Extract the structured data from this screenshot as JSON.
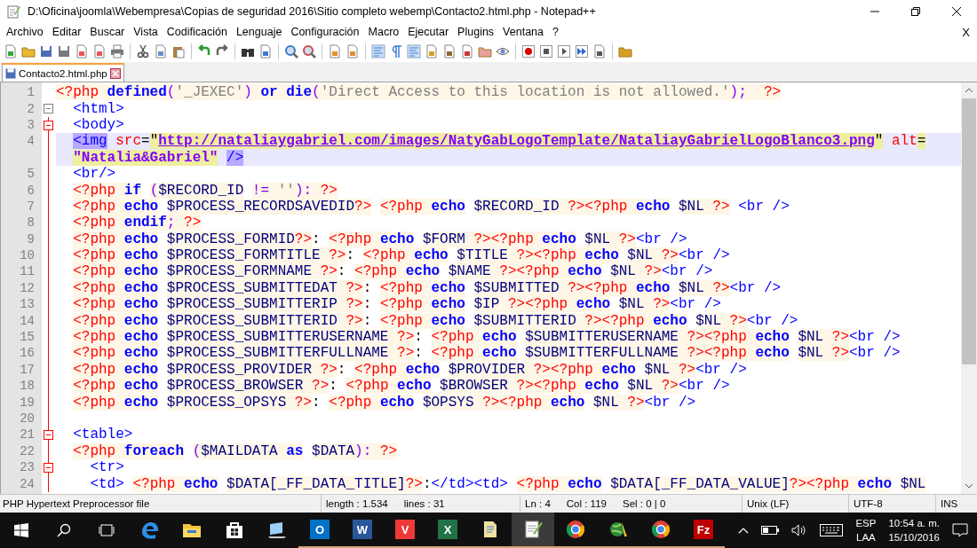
{
  "window": {
    "title": "D:\\Oficina\\joomla\\Webempresa\\Copias de seguridad 2016\\Sitio completo webemp\\Contacto2.html.php - Notepad++"
  },
  "menu": {
    "items": [
      "Archivo",
      "Editar",
      "Buscar",
      "Vista",
      "Codificación",
      "Lenguaje",
      "Configuración",
      "Macro",
      "Ejecutar",
      "Plugins",
      "Ventana",
      "?"
    ],
    "close": "X"
  },
  "tabs": [
    {
      "label": "Contacto2.html.php",
      "selected": true
    }
  ],
  "lines": [
    {
      "number": "1",
      "fold_marker": false,
      "in_block": false,
      "current": false,
      "tokens": [
        {
          "kind": "php",
          "text": "<?php "
        },
        {
          "kind": "kw",
          "text": "defined"
        },
        {
          "kind": "op",
          "text": "("
        },
        {
          "kind": "str",
          "text": "'_JEXEC'"
        },
        {
          "kind": "op",
          "text": ") "
        },
        {
          "kind": "kw",
          "text": "or die"
        },
        {
          "kind": "op",
          "text": "("
        },
        {
          "kind": "str",
          "text": "'Direct Access to this location is not allowed.'"
        },
        {
          "kind": "op",
          "text": ");  "
        },
        {
          "kind": "php",
          "text": "?>"
        }
      ]
    },
    {
      "number": "2",
      "fold_marker": true,
      "in_block": false,
      "current": false,
      "tokens": [
        {
          "kind": "tag",
          "text": "  <html>"
        }
      ]
    },
    {
      "number": "3",
      "fold_marker": true,
      "in_block": true,
      "current": false,
      "tokens": [
        {
          "kind": "tag",
          "text": "  <body>"
        }
      ]
    },
    {
      "number": "4",
      "fold_marker": false,
      "in_block": true,
      "current": true,
      "tokens": [
        {
          "kind": "match",
          "text": "  <img"
        },
        {
          "kind": "attr",
          "text": " src"
        },
        {
          "kind": "text",
          "text": "="
        },
        {
          "kind": "quote",
          "text": "\""
        },
        {
          "kind": "url",
          "text": "http://nataliaygabriel.com/images/NatyGabLogoTemplate/NataliayGabrielLogoBlanco3.png"
        },
        {
          "kind": "quote",
          "text": "\""
        },
        {
          "kind": "attr",
          "text": " alt"
        },
        {
          "kind": "quote",
          "text": "="
        }
      ],
      "continuation": [
        {
          "kind": "value",
          "text": "\"Natalia&Gabriel\""
        },
        {
          "kind": "match",
          "text": " />"
        }
      ]
    },
    {
      "number": "5",
      "fold_marker": false,
      "in_block": true,
      "current": false,
      "tokens": [
        {
          "kind": "tag",
          "text": "  <br/>"
        }
      ]
    },
    {
      "number": "6",
      "fold_marker": false,
      "in_block": true,
      "current": false,
      "tokens": [
        {
          "kind": "php",
          "text": "  <?php "
        },
        {
          "kind": "kw",
          "text": "if"
        },
        {
          "kind": "op",
          "text": " ("
        },
        {
          "kind": "var",
          "text": "$RECORD_ID"
        },
        {
          "kind": "op",
          "text": " != "
        },
        {
          "kind": "str",
          "text": "''"
        },
        {
          "kind": "op",
          "text": "): "
        },
        {
          "kind": "php",
          "text": "?>"
        }
      ]
    },
    {
      "number": "7",
      "fold_marker": false,
      "in_block": true,
      "current": false,
      "tokens": [
        {
          "kind": "php",
          "text": "  <?php "
        },
        {
          "kind": "kw",
          "text": "echo"
        },
        {
          "kind": "var",
          "text": " $PROCESS_RECORDSAVEDID"
        },
        {
          "kind": "php",
          "text": "?>"
        },
        {
          "kind": "php",
          "text": " <?php "
        },
        {
          "kind": "kw",
          "text": "echo"
        },
        {
          "kind": "var",
          "text": " $RECORD_ID "
        },
        {
          "kind": "php",
          "text": "?><?php "
        },
        {
          "kind": "kw",
          "text": "echo"
        },
        {
          "kind": "var",
          "text": " $NL "
        },
        {
          "kind": "php",
          "text": "?>"
        },
        {
          "kind": "tag",
          "text": " <br />"
        }
      ]
    },
    {
      "number": "8",
      "fold_marker": false,
      "in_block": true,
      "current": false,
      "tokens": [
        {
          "kind": "php",
          "text": "  <?php "
        },
        {
          "kind": "kw",
          "text": "endif"
        },
        {
          "kind": "op",
          "text": "; "
        },
        {
          "kind": "php",
          "text": "?>"
        }
      ]
    },
    {
      "number": "9",
      "fold_marker": false,
      "in_block": true,
      "current": false,
      "tokens": [
        {
          "kind": "php",
          "text": "  <?php "
        },
        {
          "kind": "kw",
          "text": "echo"
        },
        {
          "kind": "var",
          "text": " $PROCESS_FORMID"
        },
        {
          "kind": "php",
          "text": "?>"
        },
        {
          "kind": "text",
          "text": ":"
        },
        {
          "kind": "php",
          "text": " <?php "
        },
        {
          "kind": "kw",
          "text": "echo"
        },
        {
          "kind": "var",
          "text": " $FORM "
        },
        {
          "kind": "php",
          "text": "?><?php "
        },
        {
          "kind": "kw",
          "text": "echo"
        },
        {
          "kind": "var",
          "text": " $NL "
        },
        {
          "kind": "php",
          "text": "?>"
        },
        {
          "kind": "tag",
          "text": "<br />"
        }
      ]
    },
    {
      "number": "10",
      "fold_marker": false,
      "in_block": true,
      "current": false,
      "tokens": [
        {
          "kind": "php",
          "text": "  <?php "
        },
        {
          "kind": "kw",
          "text": "echo"
        },
        {
          "kind": "var",
          "text": " $PROCESS_FORMTITLE "
        },
        {
          "kind": "php",
          "text": "?>"
        },
        {
          "kind": "text",
          "text": ":"
        },
        {
          "kind": "php",
          "text": " <?php "
        },
        {
          "kind": "kw",
          "text": "echo"
        },
        {
          "kind": "var",
          "text": " $TITLE "
        },
        {
          "kind": "php",
          "text": "?><?php "
        },
        {
          "kind": "kw",
          "text": "echo"
        },
        {
          "kind": "var",
          "text": " $NL "
        },
        {
          "kind": "php",
          "text": "?>"
        },
        {
          "kind": "tag",
          "text": "<br />"
        }
      ]
    },
    {
      "number": "11",
      "fold_marker": false,
      "in_block": true,
      "current": false,
      "tokens": [
        {
          "kind": "php",
          "text": "  <?php "
        },
        {
          "kind": "kw",
          "text": "echo"
        },
        {
          "kind": "var",
          "text": " $PROCESS_FORMNAME "
        },
        {
          "kind": "php",
          "text": "?>"
        },
        {
          "kind": "text",
          "text": ":"
        },
        {
          "kind": "php",
          "text": " <?php "
        },
        {
          "kind": "kw",
          "text": "echo"
        },
        {
          "kind": "var",
          "text": " $NAME "
        },
        {
          "kind": "php",
          "text": "?><?php "
        },
        {
          "kind": "kw",
          "text": "echo"
        },
        {
          "kind": "var",
          "text": " $NL "
        },
        {
          "kind": "php",
          "text": "?>"
        },
        {
          "kind": "tag",
          "text": "<br />"
        }
      ]
    },
    {
      "number": "12",
      "fold_marker": false,
      "in_block": true,
      "current": false,
      "tokens": [
        {
          "kind": "php",
          "text": "  <?php "
        },
        {
          "kind": "kw",
          "text": "echo"
        },
        {
          "kind": "var",
          "text": " $PROCESS_SUBMITTEDAT "
        },
        {
          "kind": "php",
          "text": "?>"
        },
        {
          "kind": "text",
          "text": ":"
        },
        {
          "kind": "php",
          "text": " <?php "
        },
        {
          "kind": "kw",
          "text": "echo"
        },
        {
          "kind": "var",
          "text": " $SUBMITTED "
        },
        {
          "kind": "php",
          "text": "?><?php "
        },
        {
          "kind": "kw",
          "text": "echo"
        },
        {
          "kind": "var",
          "text": " $NL "
        },
        {
          "kind": "php",
          "text": "?>"
        },
        {
          "kind": "tag",
          "text": "<br />"
        }
      ]
    },
    {
      "number": "13",
      "fold_marker": false,
      "in_block": true,
      "current": false,
      "tokens": [
        {
          "kind": "php",
          "text": "  <?php "
        },
        {
          "kind": "kw",
          "text": "echo"
        },
        {
          "kind": "var",
          "text": " $PROCESS_SUBMITTERIP "
        },
        {
          "kind": "php",
          "text": "?>"
        },
        {
          "kind": "text",
          "text": ":"
        },
        {
          "kind": "php",
          "text": " <?php "
        },
        {
          "kind": "kw",
          "text": "echo"
        },
        {
          "kind": "var",
          "text": " $IP "
        },
        {
          "kind": "php",
          "text": "?><?php "
        },
        {
          "kind": "kw",
          "text": "echo"
        },
        {
          "kind": "var",
          "text": " $NL "
        },
        {
          "kind": "php",
          "text": "?>"
        },
        {
          "kind": "tag",
          "text": "<br />"
        }
      ]
    },
    {
      "number": "14",
      "fold_marker": false,
      "in_block": true,
      "current": false,
      "tokens": [
        {
          "kind": "php",
          "text": "  <?php "
        },
        {
          "kind": "kw",
          "text": "echo"
        },
        {
          "kind": "var",
          "text": " $PROCESS_SUBMITTERID "
        },
        {
          "kind": "php",
          "text": "?>"
        },
        {
          "kind": "text",
          "text": ":"
        },
        {
          "kind": "php",
          "text": " <?php "
        },
        {
          "kind": "kw",
          "text": "echo"
        },
        {
          "kind": "var",
          "text": " $SUBMITTERID "
        },
        {
          "kind": "php",
          "text": "?><?php "
        },
        {
          "kind": "kw",
          "text": "echo"
        },
        {
          "kind": "var",
          "text": " $NL "
        },
        {
          "kind": "php",
          "text": "?>"
        },
        {
          "kind": "tag",
          "text": "<br />"
        }
      ]
    },
    {
      "number": "15",
      "fold_marker": false,
      "in_block": true,
      "current": false,
      "tokens": [
        {
          "kind": "php",
          "text": "  <?php "
        },
        {
          "kind": "kw",
          "text": "echo"
        },
        {
          "kind": "var",
          "text": " $PROCESS_SUBMITTERUSERNAME "
        },
        {
          "kind": "php",
          "text": "?>"
        },
        {
          "kind": "text",
          "text": ":"
        },
        {
          "kind": "php",
          "text": " <?php "
        },
        {
          "kind": "kw",
          "text": "echo"
        },
        {
          "kind": "var",
          "text": " $SUBMITTERUSERNAME "
        },
        {
          "kind": "php",
          "text": "?><?php "
        },
        {
          "kind": "kw",
          "text": "echo"
        },
        {
          "kind": "var",
          "text": " $NL "
        },
        {
          "kind": "php",
          "text": "?>"
        },
        {
          "kind": "tag",
          "text": "<br />"
        }
      ]
    },
    {
      "number": "16",
      "fold_marker": false,
      "in_block": true,
      "current": false,
      "tokens": [
        {
          "kind": "php",
          "text": "  <?php "
        },
        {
          "kind": "kw",
          "text": "echo"
        },
        {
          "kind": "var",
          "text": " $PROCESS_SUBMITTERFULLNAME "
        },
        {
          "kind": "php",
          "text": "?>"
        },
        {
          "kind": "text",
          "text": ":"
        },
        {
          "kind": "php",
          "text": " <?php "
        },
        {
          "kind": "kw",
          "text": "echo"
        },
        {
          "kind": "var",
          "text": " $SUBMITTERFULLNAME "
        },
        {
          "kind": "php",
          "text": "?><?php "
        },
        {
          "kind": "kw",
          "text": "echo"
        },
        {
          "kind": "var",
          "text": " $NL "
        },
        {
          "kind": "php",
          "text": "?>"
        },
        {
          "kind": "tag",
          "text": "<br />"
        }
      ]
    },
    {
      "number": "17",
      "fold_marker": false,
      "in_block": true,
      "current": false,
      "tokens": [
        {
          "kind": "php",
          "text": "  <?php "
        },
        {
          "kind": "kw",
          "text": "echo"
        },
        {
          "kind": "var",
          "text": " $PROCESS_PROVIDER "
        },
        {
          "kind": "php",
          "text": "?>"
        },
        {
          "kind": "text",
          "text": ":"
        },
        {
          "kind": "php",
          "text": " <?php "
        },
        {
          "kind": "kw",
          "text": "echo"
        },
        {
          "kind": "var",
          "text": " $PROVIDER "
        },
        {
          "kind": "php",
          "text": "?><?php "
        },
        {
          "kind": "kw",
          "text": "echo"
        },
        {
          "kind": "var",
          "text": " $NL "
        },
        {
          "kind": "php",
          "text": "?>"
        },
        {
          "kind": "tag",
          "text": "<br />"
        }
      ]
    },
    {
      "number": "18",
      "fold_marker": false,
      "in_block": true,
      "current": false,
      "tokens": [
        {
          "kind": "php",
          "text": "  <?php "
        },
        {
          "kind": "kw",
          "text": "echo"
        },
        {
          "kind": "var",
          "text": " $PROCESS_BROWSER "
        },
        {
          "kind": "php",
          "text": "?>"
        },
        {
          "kind": "text",
          "text": ":"
        },
        {
          "kind": "php",
          "text": " <?php "
        },
        {
          "kind": "kw",
          "text": "echo"
        },
        {
          "kind": "var",
          "text": " $BROWSER "
        },
        {
          "kind": "php",
          "text": "?><?php "
        },
        {
          "kind": "kw",
          "text": "echo"
        },
        {
          "kind": "var",
          "text": " $NL "
        },
        {
          "kind": "php",
          "text": "?>"
        },
        {
          "kind": "tag",
          "text": "<br />"
        }
      ]
    },
    {
      "number": "19",
      "fold_marker": false,
      "in_block": true,
      "current": false,
      "tokens": [
        {
          "kind": "php",
          "text": "  <?php "
        },
        {
          "kind": "kw",
          "text": "echo"
        },
        {
          "kind": "var",
          "text": " $PROCESS_OPSYS "
        },
        {
          "kind": "php",
          "text": "?>"
        },
        {
          "kind": "text",
          "text": ":"
        },
        {
          "kind": "php",
          "text": " <?php "
        },
        {
          "kind": "kw",
          "text": "echo"
        },
        {
          "kind": "var",
          "text": " $OPSYS "
        },
        {
          "kind": "php",
          "text": "?><?php "
        },
        {
          "kind": "kw",
          "text": "echo"
        },
        {
          "kind": "var",
          "text": " $NL "
        },
        {
          "kind": "php",
          "text": "?>"
        },
        {
          "kind": "tag",
          "text": "<br />"
        }
      ]
    },
    {
      "number": "20",
      "fold_marker": false,
      "in_block": true,
      "current": false
    },
    {
      "number": "21",
      "fold_marker": true,
      "in_block": true,
      "current": false,
      "tokens": [
        {
          "kind": "tag",
          "text": "  <table>"
        }
      ]
    },
    {
      "number": "22",
      "fold_marker": false,
      "in_block": true,
      "current": false,
      "tokens": [
        {
          "kind": "php",
          "text": "  <?php "
        },
        {
          "kind": "kw",
          "text": "foreach"
        },
        {
          "kind": "op",
          "text": " ("
        },
        {
          "kind": "var",
          "text": "$MAILDATA "
        },
        {
          "kind": "kw",
          "text": "as"
        },
        {
          "kind": "var",
          "text": " $DATA"
        },
        {
          "kind": "op",
          "text": "): "
        },
        {
          "kind": "php",
          "text": "?>"
        }
      ]
    },
    {
      "number": "23",
      "fold_marker": true,
      "in_block": true,
      "current": false,
      "tokens": [
        {
          "kind": "tag",
          "text": "    <tr>"
        }
      ]
    },
    {
      "number": "24",
      "fold_marker": false,
      "in_block": true,
      "current": false,
      "tokens": [
        {
          "kind": "tag",
          "text": "    <td>"
        },
        {
          "kind": "php",
          "text": " <?php "
        },
        {
          "kind": "kw",
          "text": "echo"
        },
        {
          "kind": "var",
          "text": " $DATA[_FF_DATA_TITLE]"
        },
        {
          "kind": "php",
          "text": "?>"
        },
        {
          "kind": "text",
          "text": ":"
        },
        {
          "kind": "tag",
          "text": "</td><td>"
        },
        {
          "kind": "php",
          "text": " <?php "
        },
        {
          "kind": "kw",
          "text": "echo"
        },
        {
          "kind": "var",
          "text": " $DATA[_FF_DATA_VALUE]"
        },
        {
          "kind": "php",
          "text": "?><?php "
        },
        {
          "kind": "kw",
          "text": "echo"
        },
        {
          "kind": "var",
          "text": " $NL"
        }
      ]
    }
  ],
  "status_bar": {
    "file_type": "PHP Hypertext Preprocessor file",
    "length": "length : 1.534",
    "lines": "lines : 31",
    "ln": "Ln : 4",
    "col": "Col : 119",
    "sel": "Sel : 0 | 0",
    "eol": "Unix (LF)",
    "encoding": "UTF-8",
    "mode": "INS"
  },
  "taskbar": {
    "apps": [
      {
        "kind": "edge",
        "running": false,
        "active": false
      },
      {
        "kind": "folder",
        "running": false,
        "active": false
      },
      {
        "kind": "store",
        "running": false,
        "active": false
      },
      {
        "kind": "monitor",
        "running": false,
        "active": false
      },
      {
        "kind": "letter",
        "glyph": "O",
        "color": "#0072c6",
        "running": true,
        "active": false
      },
      {
        "kind": "letter",
        "glyph": "W",
        "color": "#2b579a",
        "running": true,
        "active": false
      },
      {
        "kind": "letter",
        "glyph": "V",
        "color": "#ef3939",
        "running": true,
        "active": false
      },
      {
        "kind": "letter",
        "glyph": "X",
        "color": "#217346",
        "running": true,
        "active": false
      },
      {
        "kind": "document",
        "running": true,
        "active": false
      },
      {
        "kind": "notepad",
        "running": true,
        "active": true
      },
      {
        "kind": "chrome",
        "running": true,
        "active": false
      },
      {
        "kind": "globe",
        "running": true,
        "active": false
      },
      {
        "kind": "chrome",
        "running": true,
        "active": false
      },
      {
        "kind": "letter",
        "glyph": "Fz",
        "color": "#bf0000",
        "running": true,
        "active": false
      }
    ],
    "language": "ESP",
    "layout": "LAA",
    "time": "10:54 a. m.",
    "date": "15/10/2016"
  }
}
